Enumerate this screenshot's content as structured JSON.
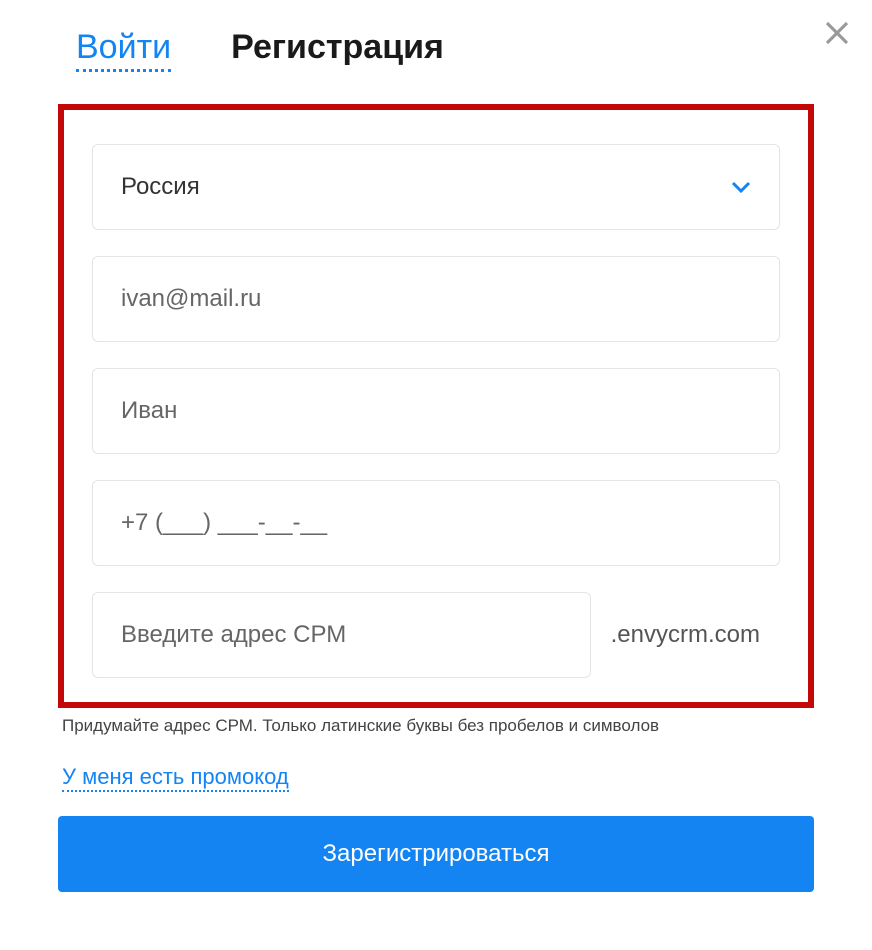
{
  "tabs": {
    "login": "Войти",
    "register": "Регистрация"
  },
  "form": {
    "country": "Россия",
    "email_placeholder": "ivan@mail.ru",
    "name_placeholder": "Иван",
    "phone_placeholder": "+7 (___) ___-__-__",
    "crm_placeholder": "Введите адрес СРМ",
    "crm_suffix": ".envycrm.com",
    "hint": "Придумайте адрес СРМ. Только латинские буквы без пробелов и символов"
  },
  "promo_link": "У меня есть промокод",
  "submit": "Зарегистрироваться"
}
